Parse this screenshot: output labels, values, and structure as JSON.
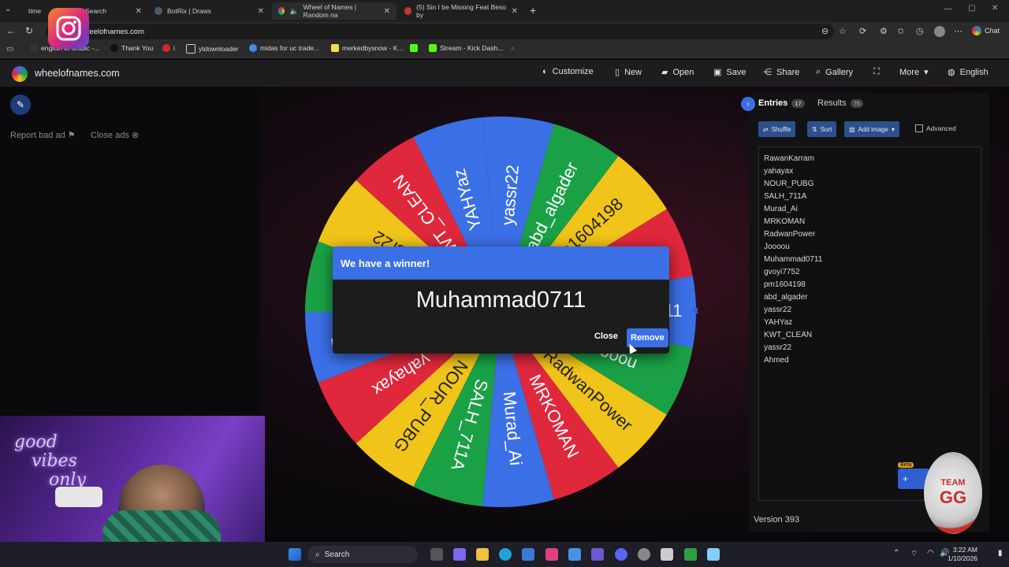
{
  "browser": {
    "tabs": [
      {
        "label": "time",
        "suffix": "Search"
      },
      {
        "label": "BotRix | Draws"
      },
      {
        "label": "Wheel of Names | Random na"
      },
      {
        "label": "(5) Sin I be Missing Feat Beso by"
      }
    ],
    "url": "heelofnames.com",
    "chat_label": "Chat",
    "bookmarks": [
      "english to arabic -...",
      "Thank You",
      "i",
      "ytdownloader",
      "midas for uc trade...",
      "merkedbysnow - K...",
      "Stream - Kick Dash..."
    ]
  },
  "site": {
    "brand": "wheelofnames.com",
    "menu": [
      "Customize",
      "New",
      "Open",
      "Save",
      "Share",
      "Gallery",
      "More",
      "English"
    ]
  },
  "ads": {
    "report": "Report bad ad",
    "close": "Close ads"
  },
  "wheel": {
    "segments": [
      {
        "label": "yassr22",
        "color": "#3b6fe6"
      },
      {
        "label": "abd_algader",
        "color": "#1aa146"
      },
      {
        "label": "pm1604198",
        "color": "#f0c419"
      },
      {
        "label": "gvoyi7752",
        "color": "#e0283c"
      },
      {
        "label": "Muhammad0711",
        "color": "#3b6fe6"
      },
      {
        "label": "Joooou",
        "color": "#1aa146"
      },
      {
        "label": "RadwanPower",
        "color": "#f0c419"
      },
      {
        "label": "MRKOMAN",
        "color": "#e0283c"
      },
      {
        "label": "Murad_Ai",
        "color": "#3b6fe6"
      },
      {
        "label": "SALH_711A",
        "color": "#1aa146"
      },
      {
        "label": "NOUR_PUBG",
        "color": "#f0c419"
      },
      {
        "label": "yahayax",
        "color": "#e0283c"
      },
      {
        "label": "RawanKarram",
        "color": "#3b6fe6"
      },
      {
        "label": "Ahmed",
        "color": "#1aa146"
      },
      {
        "label": "yassr22",
        "color": "#f0c419"
      },
      {
        "label": "KWT_CLEAN",
        "color": "#e0283c"
      },
      {
        "label": "YAHYaz",
        "color": "#3b6fe6"
      }
    ]
  },
  "dialog": {
    "title": "We have a winner!",
    "winner": "Muhammad0711",
    "close_label": "Close",
    "remove_label": "Remove"
  },
  "panel": {
    "tab_entries": "Entries",
    "entries_count": "17",
    "tab_results": "Results",
    "results_count": "75",
    "tools": [
      "Shuffle",
      "Sort",
      "Add image"
    ],
    "advanced": "Advanced",
    "entries": [
      "RawanKarram",
      "yahayax",
      "NOUR_PUBG",
      "SALH_711A",
      "Murad_Ai",
      "MRKOMAN",
      "RadwanPower",
      "Joooou",
      "Muhammad0711",
      "gvoyi7752",
      "pm1604198",
      "abd_algader",
      "yassr22",
      "YAHYaz",
      "KWT_CLEAN",
      "yassr22",
      "Ahmed"
    ],
    "version": "Version 393",
    "beta": "Beta"
  },
  "overlay": {
    "neon_text": [
      "good",
      "vibes",
      "only"
    ],
    "team": "TEAM",
    "team_short": "GG"
  },
  "taskbar": {
    "search": "Search",
    "time": "3:22 AM",
    "date": "1/10/2026"
  }
}
